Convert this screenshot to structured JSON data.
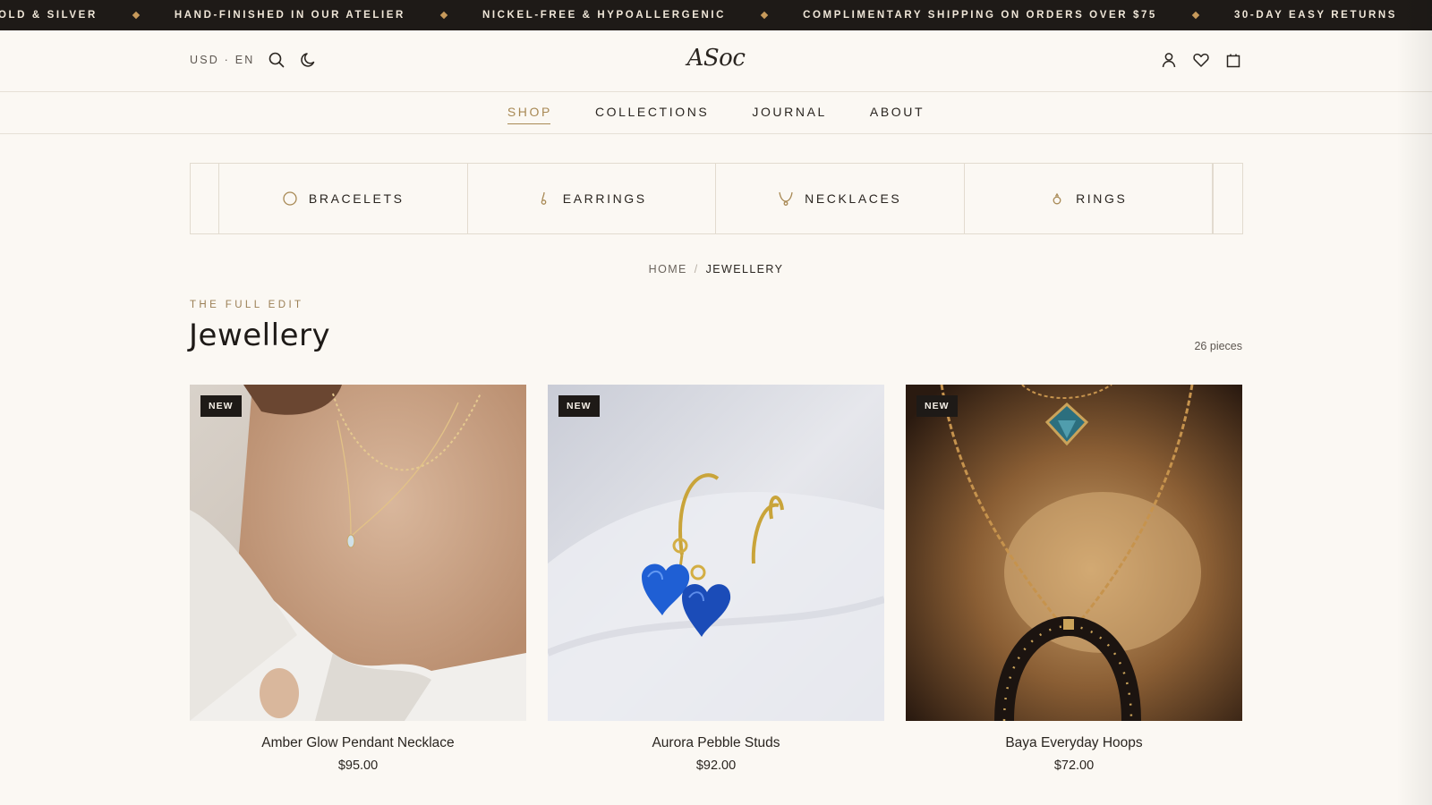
{
  "announcement": {
    "items": [
      "OLD & SILVER",
      "HAND-FINISHED IN OUR ATELIER",
      "NICKEL-FREE & HYPOALLERGENIC",
      "COMPLIMENTARY SHIPPING ON ORDERS OVER $75",
      "30-DAY EASY RETURNS"
    ]
  },
  "header": {
    "locale": "USD · EN",
    "logo": "ASoc",
    "icons": [
      "search-icon",
      "moon-icon",
      "account-icon",
      "wishlist-icon",
      "bag-icon"
    ]
  },
  "nav": {
    "items": [
      {
        "label": "SHOP",
        "active": true
      },
      {
        "label": "COLLECTIONS",
        "active": false
      },
      {
        "label": "JOURNAL",
        "active": false
      },
      {
        "label": "ABOUT",
        "active": false
      }
    ]
  },
  "categories": [
    {
      "label": "BRACELETS",
      "icon": "bracelet-icon"
    },
    {
      "label": "EARRINGS",
      "icon": "earring-icon"
    },
    {
      "label": "NECKLACES",
      "icon": "necklace-icon"
    },
    {
      "label": "RINGS",
      "icon": "ring-icon"
    }
  ],
  "breadcrumb": {
    "home": "HOME",
    "separator": "/",
    "current": "JEWELLERY"
  },
  "page": {
    "eyebrow": "THE FULL EDIT",
    "title": "Jewellery",
    "count": "26 pieces"
  },
  "products": [
    {
      "badge": "NEW",
      "name": "Amber Glow Pendant Necklace",
      "price": "$95.00"
    },
    {
      "badge": "NEW",
      "name": "Aurora Pebble Studs",
      "price": "$92.00"
    },
    {
      "badge": "NEW",
      "name": "Baya Everyday Hoops",
      "price": "$72.00"
    }
  ],
  "colors": {
    "accent": "#a88954",
    "announcement_bg": "#1e1a17",
    "page_bg": "#fbf8f3",
    "badge_bg": "#1e1a17"
  }
}
